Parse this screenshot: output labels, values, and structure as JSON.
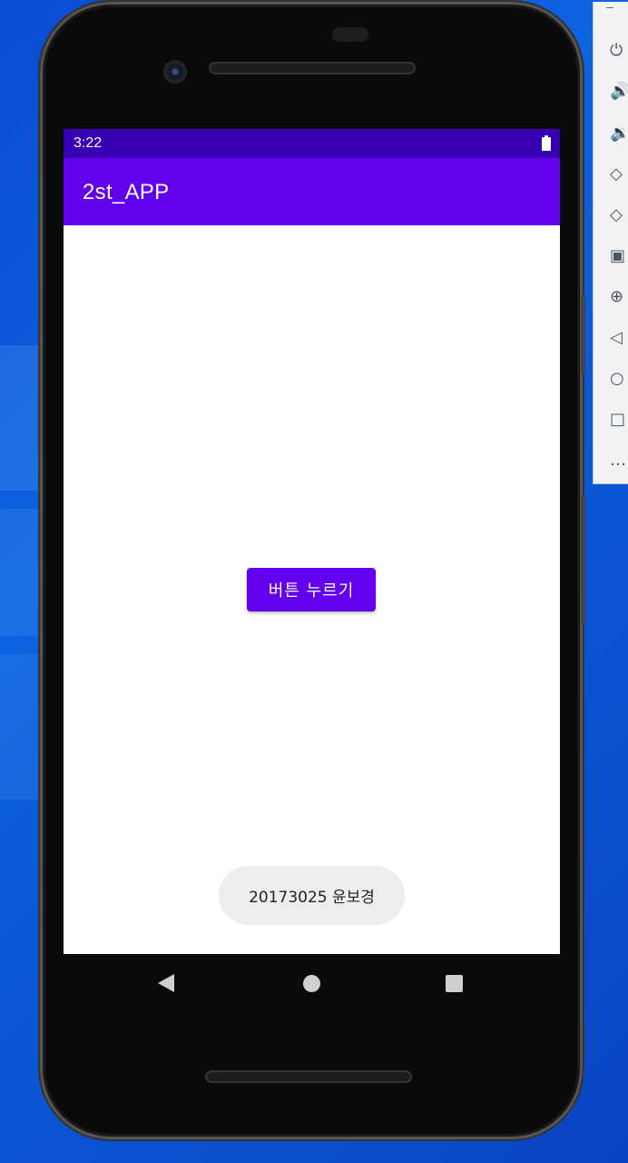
{
  "statusbar": {
    "time": "3:22"
  },
  "app": {
    "title": "2st_APP"
  },
  "main": {
    "button_label": "버튼 누르기"
  },
  "toast": {
    "text": "20173025 윤보경"
  },
  "navbar": {
    "back": "back-icon",
    "home": "home-icon",
    "recents": "recents-icon"
  },
  "emulator_toolbar": {
    "items": [
      "minimize-icon",
      "power-icon",
      "volume-up-icon",
      "volume-down-icon",
      "rotate-left-icon",
      "rotate-right-icon",
      "camera-icon",
      "zoom-icon",
      "back-icon",
      "home-icon",
      "overview-icon",
      "more-icon"
    ]
  },
  "colors": {
    "statusbar": "#3700b3",
    "appbar": "#6200ee",
    "button": "#6200ee",
    "toast_bg": "#eeeeee"
  }
}
